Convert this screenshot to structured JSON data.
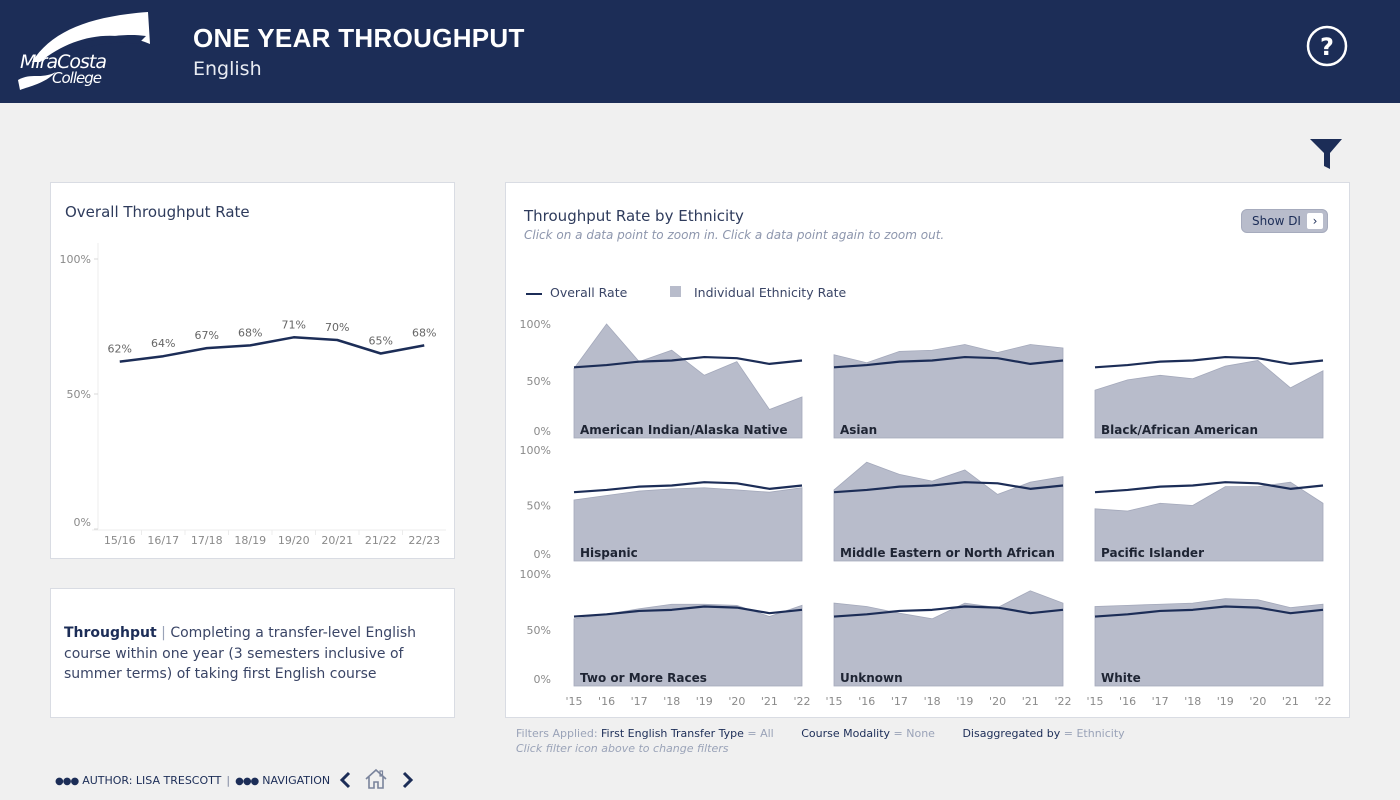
{
  "header": {
    "logo_line1": "MiraCosta",
    "logo_line2": "College",
    "title": "ONE YEAR THROUGHPUT",
    "subtitle": "English",
    "help_icon": "question-circle-icon"
  },
  "toolbar": {
    "filter_icon": "filter-icon"
  },
  "colors": {
    "header_bg": "#1c2d57",
    "overall_line": "#1c2d57",
    "ethnicity_area": "#b8bccb",
    "page_bg": "#f0f0f0"
  },
  "overall_panel": {
    "title": "Overall Throughput Rate"
  },
  "definition": {
    "term": "Throughput",
    "separator": "|",
    "text": "Completing a transfer-level English course within one year (3 semesters inclusive of summer terms) of taking first English course"
  },
  "ethnicity_panel": {
    "title": "Throughput Rate by Ethnicity",
    "subtitle": "Click on a data point to zoom in. Click a data point again to zoom out.",
    "show_di_label": "Show DI",
    "show_di_icon": "chevron-right-icon",
    "legend": [
      {
        "label": "Overall Rate",
        "kind": "line"
      },
      {
        "label": "Individual Ethnicity Rate",
        "kind": "area"
      }
    ]
  },
  "filters": {
    "prefix": "Filters Applied:",
    "items": [
      {
        "name": "First English Transfer Type",
        "value": "= All"
      },
      {
        "name": "Course Modality",
        "value": "= None"
      },
      {
        "name": "Disaggregated by",
        "value": "= Ethnicity"
      }
    ],
    "hint": "Click filter icon above to change filters"
  },
  "footer": {
    "author": "AUTHOR: LISA TRESCOTT",
    "separator": "|",
    "navigation": "NAVIGATION"
  },
  "chart_data": [
    {
      "type": "line",
      "title": "Overall Throughput Rate",
      "categories": [
        "15/16",
        "16/17",
        "17/18",
        "18/19",
        "19/20",
        "20/21",
        "21/22",
        "22/23"
      ],
      "values": [
        62,
        64,
        67,
        68,
        71,
        70,
        65,
        68
      ],
      "data_labels": [
        "62%",
        "64%",
        "67%",
        "68%",
        "71%",
        "70%",
        "65%",
        "68%"
      ],
      "ylim": [
        0,
        100
      ],
      "yticks": [
        "0%",
        "50%",
        "100%"
      ],
      "grid": false
    },
    {
      "type": "area",
      "title": "Throughput Rate by Ethnicity",
      "categories": [
        "'15",
        "'16",
        "'17",
        "'18",
        "'19",
        "'20",
        "'21",
        "'22"
      ],
      "ylim": [
        0,
        100
      ],
      "yticks": [
        "0%",
        "50%",
        "100%"
      ],
      "overall": [
        62,
        64,
        67,
        68,
        71,
        70,
        65,
        68
      ],
      "legend": "top-left",
      "panels": [
        {
          "name": "American Indian/Alaska Native",
          "values": [
            61,
            100,
            67,
            77,
            55,
            67,
            25,
            36
          ]
        },
        {
          "name": "Asian",
          "values": [
            73,
            66,
            76,
            77,
            82,
            75,
            82,
            79
          ]
        },
        {
          "name": "Black/African American",
          "values": [
            42,
            51,
            55,
            52,
            63,
            68,
            44,
            59
          ]
        },
        {
          "name": "Hispanic",
          "values": [
            55,
            59,
            63,
            65,
            66,
            64,
            62,
            66
          ]
        },
        {
          "name": "Middle Eastern or North African",
          "values": [
            64,
            89,
            78,
            72,
            82,
            60,
            71,
            76
          ]
        },
        {
          "name": "Pacific Islander",
          "values": [
            47,
            45,
            52,
            50,
            67,
            67,
            71,
            52
          ]
        },
        {
          "name": "Two or More Races",
          "values": [
            60,
            64,
            69,
            73,
            73,
            72,
            62,
            72
          ]
        },
        {
          "name": "Unknown",
          "values": [
            74,
            71,
            65,
            60,
            74,
            70,
            85,
            74
          ]
        },
        {
          "name": "White",
          "values": [
            71,
            72,
            73,
            74,
            78,
            77,
            70,
            73
          ]
        }
      ]
    }
  ]
}
